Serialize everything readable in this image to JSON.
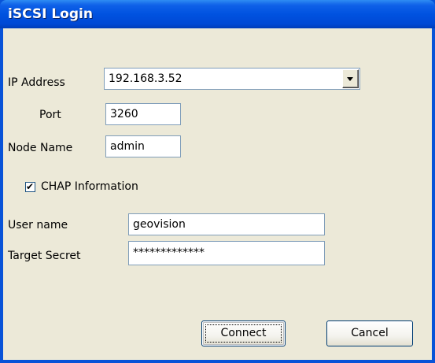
{
  "window": {
    "title": "iSCSI Login"
  },
  "form": {
    "ip_address": {
      "label": "IP Address",
      "value": "192.168.3.52"
    },
    "port": {
      "label": "Port",
      "value": "3260"
    },
    "node_name": {
      "label": "Node Name",
      "value": "admin"
    },
    "chap": {
      "label": "CHAP Information",
      "checked": true,
      "check_glyph": "✔"
    },
    "user_name": {
      "label": "User name",
      "value": "geovision"
    },
    "target_secret": {
      "label": "Target Secret",
      "value": "*************"
    }
  },
  "buttons": {
    "connect": "Connect",
    "cancel": "Cancel"
  },
  "colors": {
    "title_bar": "#0052e0",
    "dialog_face": "#ece9d8",
    "input_border": "#7f9db9"
  }
}
